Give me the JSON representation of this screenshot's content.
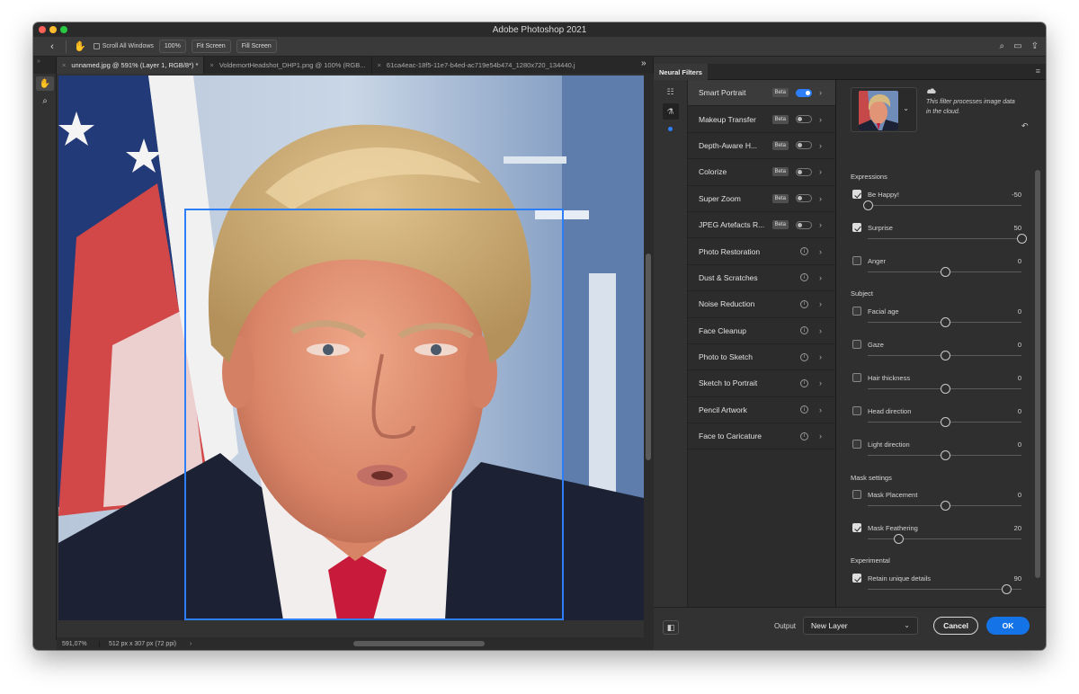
{
  "window": {
    "title": "Adobe Photoshop 2021"
  },
  "options_bar": {
    "scroll_all_label": "Scroll All Windows",
    "zoom_btn": "100%",
    "fit_screen_btn": "Fit Screen",
    "fill_screen_btn": "Fill Screen"
  },
  "tabs": [
    {
      "label": "unnamed.jpg @ 591% (Layer 1, RGB/8*) *",
      "active": true
    },
    {
      "label": "VoldemortHeadshot_DHP1.png @ 100% (RGB...",
      "active": false
    },
    {
      "label": "61ca4eac-18f5-11e7-b4ed-ac719e54b474_1280x720_134440.j",
      "active": false
    }
  ],
  "status": {
    "zoom": "591,07%",
    "dimensions": "512 px x 307 px (72 ppi)"
  },
  "neural_filters": {
    "panel_title": "Neural Filters",
    "filters": [
      {
        "name": "Smart Portrait",
        "beta": "Beta",
        "kind": "toggle",
        "on": true,
        "active": true
      },
      {
        "name": "Makeup Transfer",
        "beta": "Beta",
        "kind": "toggle",
        "on": false
      },
      {
        "name": "Depth-Aware H...",
        "beta": "Beta",
        "kind": "toggle",
        "on": false
      },
      {
        "name": "Colorize",
        "beta": "Beta",
        "kind": "toggle",
        "on": false
      },
      {
        "name": "Super Zoom",
        "beta": "Beta",
        "kind": "toggle",
        "on": false
      },
      {
        "name": "JPEG Artefacts R...",
        "beta": "Beta",
        "kind": "toggle",
        "on": false
      },
      {
        "name": "Photo Restoration",
        "kind": "info"
      },
      {
        "name": "Dust & Scratches",
        "kind": "info"
      },
      {
        "name": "Noise Reduction",
        "kind": "info"
      },
      {
        "name": "Face Cleanup",
        "kind": "info"
      },
      {
        "name": "Photo to Sketch",
        "kind": "info"
      },
      {
        "name": "Sketch to Portrait",
        "kind": "info"
      },
      {
        "name": "Pencil Artwork",
        "kind": "info"
      },
      {
        "name": "Face to Caricature",
        "kind": "info"
      }
    ],
    "cloud_note": "This filter processes image data in the cloud.",
    "sections": {
      "expressions": "Expressions",
      "subject": "Subject",
      "mask_settings": "Mask settings",
      "experimental": "Experimental"
    },
    "sliders": [
      {
        "label": "Be Happy!",
        "value": "-50",
        "checked": true,
        "pos": 0.0
      },
      {
        "label": "Surprise",
        "value": "50",
        "checked": true,
        "pos": 1.0
      },
      {
        "label": "Anger",
        "value": "0",
        "checked": false,
        "pos": 0.5
      },
      {
        "label": "Facial age",
        "value": "0",
        "checked": false,
        "pos": 0.5
      },
      {
        "label": "Gaze",
        "value": "0",
        "checked": false,
        "pos": 0.5
      },
      {
        "label": "Hair thickness",
        "value": "0",
        "checked": false,
        "pos": 0.5
      },
      {
        "label": "Head direction",
        "value": "0",
        "checked": false,
        "pos": 0.5
      },
      {
        "label": "Light direction",
        "value": "0",
        "checked": false,
        "pos": 0.5
      },
      {
        "label": "Mask Placement",
        "value": "0",
        "checked": false,
        "pos": 0.5
      },
      {
        "label": "Mask Feathering",
        "value": "20",
        "checked": true,
        "pos": 0.2
      },
      {
        "label": "Retain unique details",
        "value": "90",
        "checked": true,
        "pos": 0.9
      }
    ],
    "output_label": "Output",
    "output_value": "New Layer",
    "cancel": "Cancel",
    "ok": "OK"
  },
  "colors": {
    "accent": "#1473e6",
    "selection": "#2d7ff9"
  }
}
